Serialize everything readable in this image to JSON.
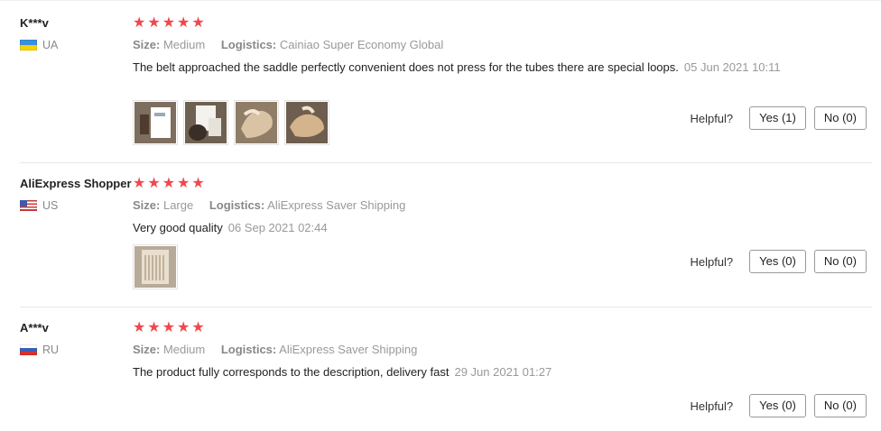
{
  "colors": {
    "star": "#f0484d",
    "muted": "#999999",
    "divider": "#e8e8e8"
  },
  "helpful_label": "Helpful?",
  "reviews": [
    {
      "user": "K***v",
      "country": "UA",
      "flag_icon": "ukraine-flag-icon",
      "rating": 5,
      "size_label": "Size:",
      "size_value": "Medium",
      "logistics_label": "Logistics:",
      "logistics_value": "Cainiao Super Economy Global",
      "text": "The belt approached the saddle perfectly convenient does not press for the tubes there are special loops.",
      "date": "05 Jun 2021 10:11",
      "photo_count": 4,
      "yes": "Yes (1)",
      "no": "No (0)"
    },
    {
      "user": "AliExpress Shopper",
      "country": "US",
      "flag_icon": "usa-flag-icon",
      "rating": 5,
      "size_label": "Size:",
      "size_value": "Large",
      "logistics_label": "Logistics:",
      "logistics_value": "AliExpress Saver Shipping",
      "text": "Very good quality",
      "date": "06 Sep 2021 02:44",
      "photo_count": 1,
      "yes": "Yes (0)",
      "no": "No (0)"
    },
    {
      "user": "A***v",
      "country": "RU",
      "flag_icon": "russia-flag-icon",
      "rating": 5,
      "size_label": "Size:",
      "size_value": "Medium",
      "logistics_label": "Logistics:",
      "logistics_value": "AliExpress Saver Shipping",
      "text": "The product fully corresponds to the description, delivery fast",
      "date": "29 Jun 2021 01:27",
      "photo_count": 0,
      "yes": "Yes (0)",
      "no": "No (0)"
    }
  ]
}
